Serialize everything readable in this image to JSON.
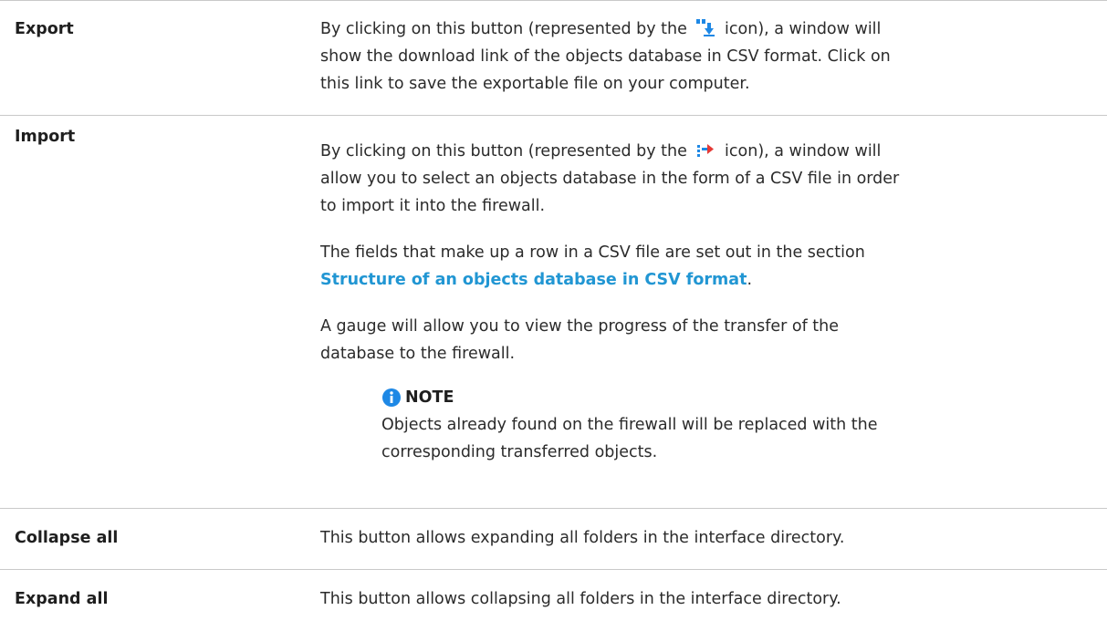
{
  "rows": [
    {
      "term": "Export",
      "desc_before_icon": "By clicking on this button (represented by the ",
      "desc_after_icon": " icon), a window will show the download link of the objects database in CSV format. Click on this link to save the exportable file on your computer.",
      "icon": "export-download-icon"
    },
    {
      "term": "Import",
      "desc_before_icon": "By clicking on this button (represented by the ",
      "desc_after_icon": " icon), a window will allow you to select an objects database in the form of a CSV file in order to import it into the firewall.",
      "icon": "import-arrow-icon",
      "para2_before_link": "The fields that make up a row in a CSV file are set out in the section ",
      "para2_link": "Structure of an objects database in CSV format",
      "para2_after_link": ".",
      "para3": "A gauge will allow you to view the progress of the transfer of the database to the firewall.",
      "note": {
        "title": "NOTE",
        "text": "Objects already found on the firewall will be replaced with the corresponding transferred objects.",
        "icon": "info-icon"
      }
    },
    {
      "term": "Collapse all",
      "desc": "This button allows expanding all folders in the interface directory."
    },
    {
      "term": "Expand all",
      "desc": "This button allows collapsing all folders in the interface directory."
    }
  ],
  "colors": {
    "link": "#2196d3",
    "border": "#c9c9c9",
    "icon_blue": "#1e88e5"
  }
}
